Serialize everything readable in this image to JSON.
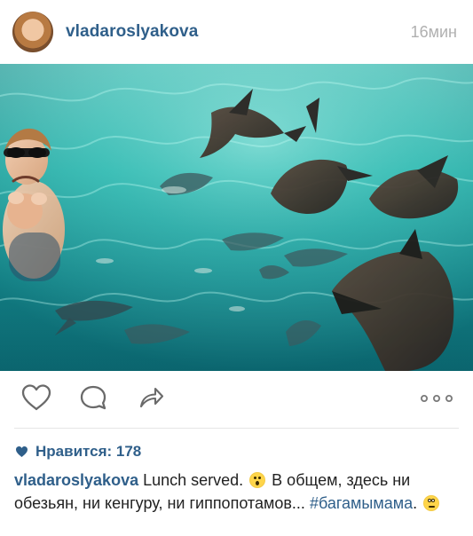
{
  "header": {
    "username": "vladaroslyakova",
    "timestamp": "16мин"
  },
  "photo": {
    "description": "Underwater photo of a woman in turquoise water surrounded by nurse sharks"
  },
  "actions": {
    "like_icon": "heart-outline-icon",
    "comment_icon": "comment-bubble-icon",
    "share_icon": "share-arrow-icon",
    "more_icon": "more-dots-icon"
  },
  "likes": {
    "label": "Нравится: 178"
  },
  "caption": {
    "username": "vladaroslyakova",
    "text_part1": " Lunch served. ",
    "text_part2": " В общем, здесь ни обезьян, ни кенгуру, ни гиппопотамов... ",
    "hashtag": "#багамымама",
    "text_part3": ". "
  },
  "colors": {
    "brand": "#2f5f8a",
    "muted": "#b0b0b0",
    "icon": "#555555"
  }
}
